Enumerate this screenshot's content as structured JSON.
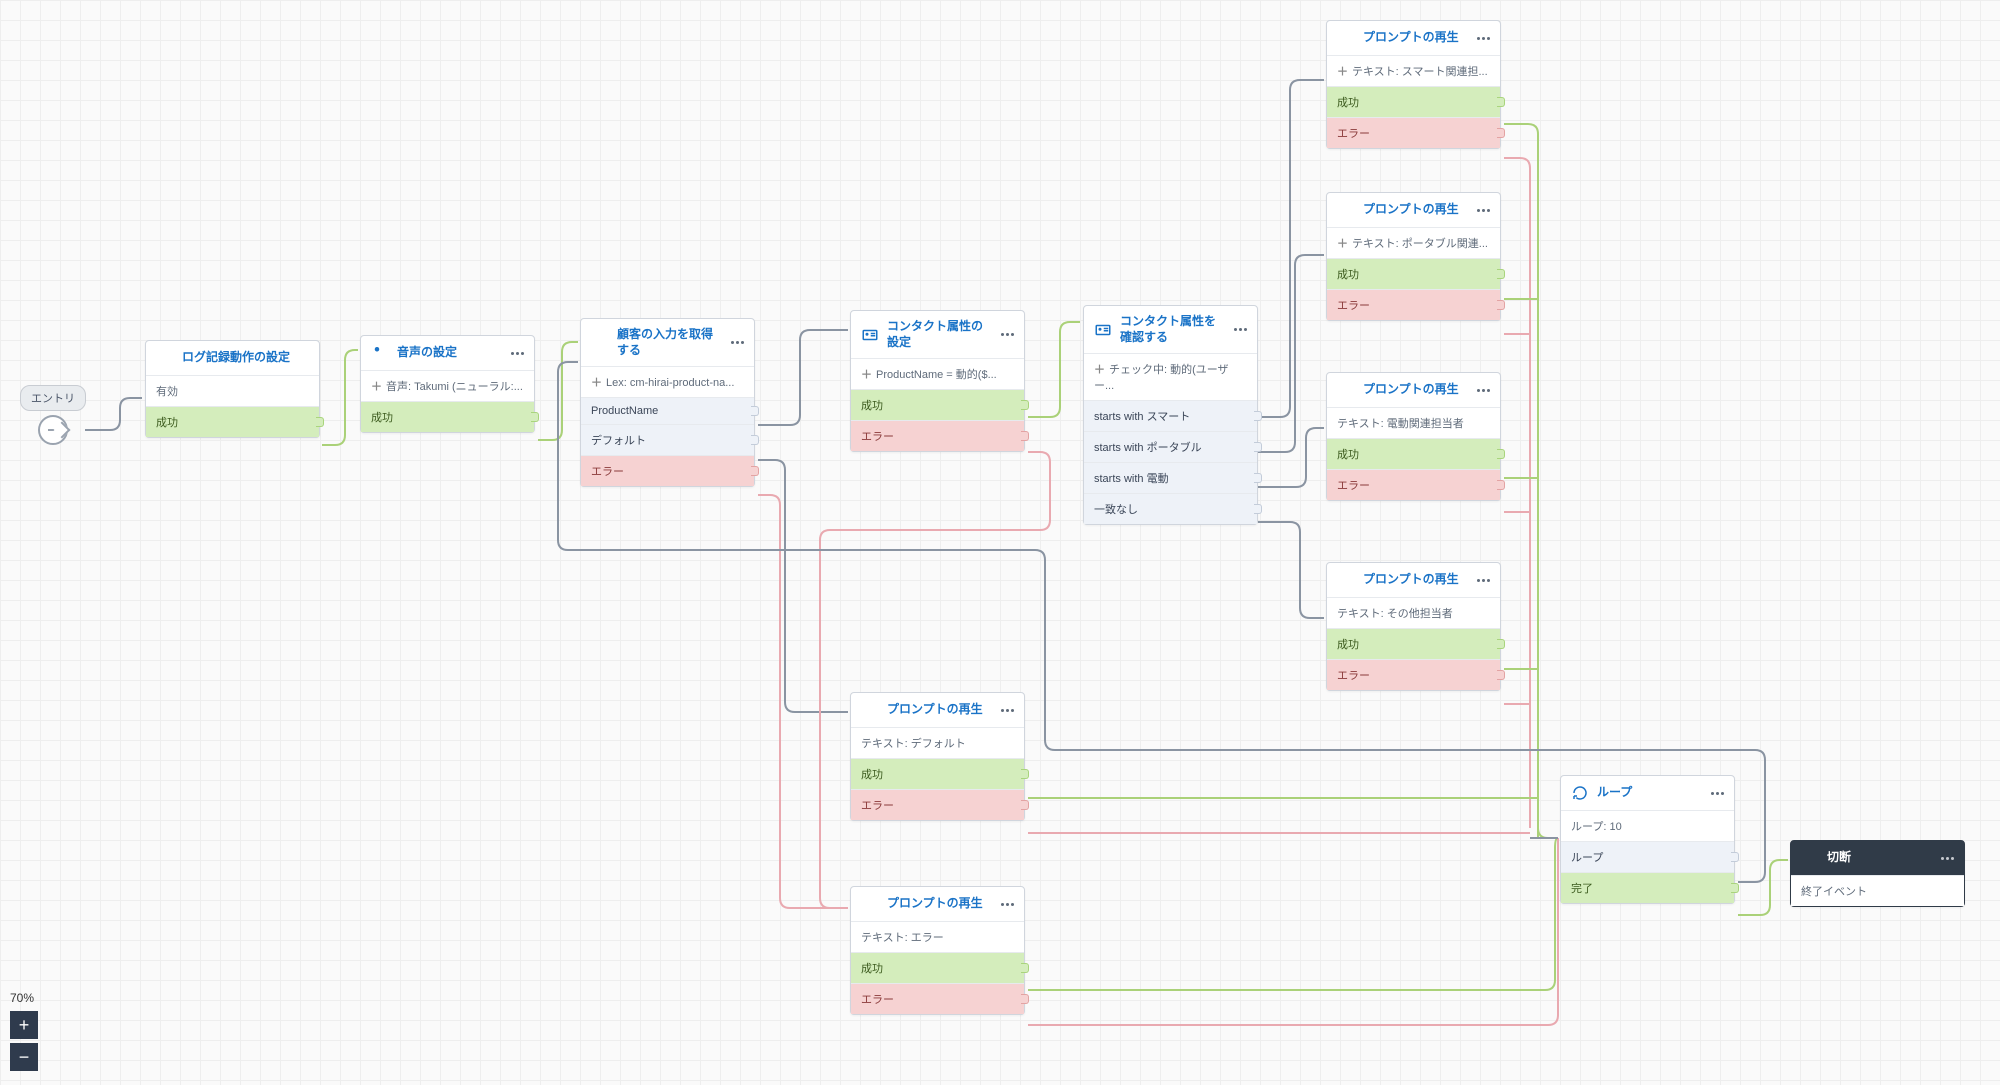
{
  "zoom": "70%",
  "entry": {
    "label": "エントリ"
  },
  "nodes": {
    "logging": {
      "title": "ログ記録動作の設定",
      "rows": [
        {
          "kind": "info",
          "text": "有効"
        },
        {
          "kind": "success",
          "text": "成功"
        }
      ]
    },
    "voice": {
      "title": "音声の設定",
      "rows": [
        {
          "kind": "info",
          "plus": true,
          "text": "音声: Takumi (ニューラル:..."
        },
        {
          "kind": "success",
          "text": "成功"
        }
      ]
    },
    "getInput": {
      "title": "顧客の入力を取得する",
      "rows": [
        {
          "kind": "info",
          "plus": true,
          "text": "Lex: cm-hirai-product-na..."
        },
        {
          "kind": "branch",
          "text": "ProductName"
        },
        {
          "kind": "branch",
          "text": "デフォルト"
        },
        {
          "kind": "error",
          "text": "エラー"
        }
      ]
    },
    "setAttr": {
      "title": "コンタクト属性の設定",
      "rows": [
        {
          "kind": "info",
          "plus": true,
          "text": "ProductName = 動的($..."
        },
        {
          "kind": "success",
          "text": "成功"
        },
        {
          "kind": "error",
          "text": "エラー"
        }
      ]
    },
    "checkAttr": {
      "title": "コンタクト属性を確認する",
      "rows": [
        {
          "kind": "info",
          "plus": true,
          "text": "チェック中: 動的(ユーザー..."
        },
        {
          "kind": "branch",
          "text": "starts with スマート"
        },
        {
          "kind": "branch",
          "text": "starts with ポータブル"
        },
        {
          "kind": "branch",
          "text": "starts with 電動"
        },
        {
          "kind": "branch",
          "text": "一致なし"
        }
      ]
    },
    "prompt1": {
      "title": "プロンプトの再生",
      "rows": [
        {
          "kind": "info",
          "plus": true,
          "text": "テキスト: スマート関連担..."
        },
        {
          "kind": "success",
          "text": "成功"
        },
        {
          "kind": "error",
          "text": "エラー"
        }
      ]
    },
    "prompt2": {
      "title": "プロンプトの再生",
      "rows": [
        {
          "kind": "info",
          "plus": true,
          "text": "テキスト: ポータブル関連..."
        },
        {
          "kind": "success",
          "text": "成功"
        },
        {
          "kind": "error",
          "text": "エラー"
        }
      ]
    },
    "prompt3": {
      "title": "プロンプトの再生",
      "rows": [
        {
          "kind": "info",
          "text": "テキスト: 電動関連担当者"
        },
        {
          "kind": "success",
          "text": "成功"
        },
        {
          "kind": "error",
          "text": "エラー"
        }
      ]
    },
    "prompt4": {
      "title": "プロンプトの再生",
      "rows": [
        {
          "kind": "info",
          "text": "テキスト: その他担当者"
        },
        {
          "kind": "success",
          "text": "成功"
        },
        {
          "kind": "error",
          "text": "エラー"
        }
      ]
    },
    "promptDefault": {
      "title": "プロンプトの再生",
      "rows": [
        {
          "kind": "info",
          "text": "テキスト: デフォルト"
        },
        {
          "kind": "success",
          "text": "成功"
        },
        {
          "kind": "error",
          "text": "エラー"
        }
      ]
    },
    "promptError": {
      "title": "プロンプトの再生",
      "rows": [
        {
          "kind": "info",
          "text": "テキスト: エラー"
        },
        {
          "kind": "success",
          "text": "成功"
        },
        {
          "kind": "error",
          "text": "エラー"
        }
      ]
    },
    "loop": {
      "title": "ループ",
      "rows": [
        {
          "kind": "info",
          "text": "ループ: 10"
        },
        {
          "kind": "branch",
          "text": "ループ"
        },
        {
          "kind": "success",
          "text": "完了"
        }
      ]
    },
    "disconnect": {
      "title": "切断",
      "rows": [
        {
          "kind": "info",
          "text": "終了イベント"
        }
      ]
    }
  }
}
